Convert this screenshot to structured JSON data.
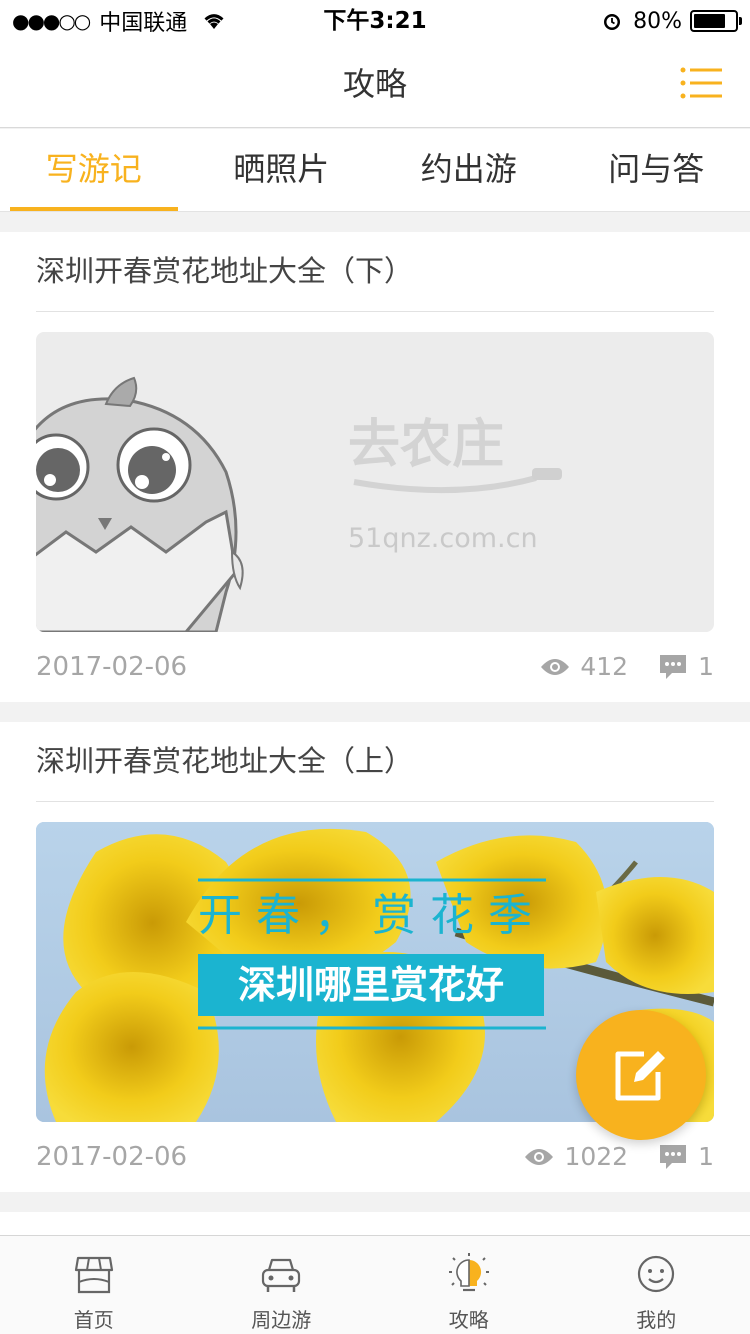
{
  "status_bar": {
    "signal": "●●●○○",
    "carrier": "中国联通",
    "wifi_icon": "wifi-icon",
    "time": "下午3:21",
    "alarm_icon": "alarm-icon",
    "battery": "80%",
    "battery_level": 0.8
  },
  "header": {
    "title": "攻略",
    "menu_icon": "list-menu-icon"
  },
  "tabs": [
    {
      "label": "写游记",
      "active": true
    },
    {
      "label": "晒照片",
      "active": false
    },
    {
      "label": "约出游",
      "active": false
    },
    {
      "label": "问与答",
      "active": false
    }
  ],
  "posts": [
    {
      "title": "深圳开春赏花地址大全（下）",
      "image": {
        "type": "placeholder",
        "logo_text": "去农庄",
        "site_text": "51qnz.com.cn"
      },
      "date": "2017-02-06",
      "views": "412",
      "comments": "1"
    },
    {
      "title": "深圳开春赏花地址大全（上）",
      "image": {
        "type": "banner",
        "headline": "开春，赏花季",
        "subheadline": "深圳哪里赏花好"
      },
      "date": "2017-02-06",
      "views": "1022",
      "comments": "1"
    }
  ],
  "fab": {
    "icon": "edit-icon"
  },
  "tab_bar": [
    {
      "label": "首页",
      "icon": "shop-icon",
      "active": false
    },
    {
      "label": "周边游",
      "icon": "car-icon",
      "active": false
    },
    {
      "label": "攻略",
      "icon": "lightbulb-icon",
      "active": true
    },
    {
      "label": "我的",
      "icon": "smiley-icon",
      "active": false
    }
  ],
  "colors": {
    "accent": "#f8b21e",
    "banner_cyan": "#1bb4d0",
    "text_gray": "#a6a6a6"
  }
}
